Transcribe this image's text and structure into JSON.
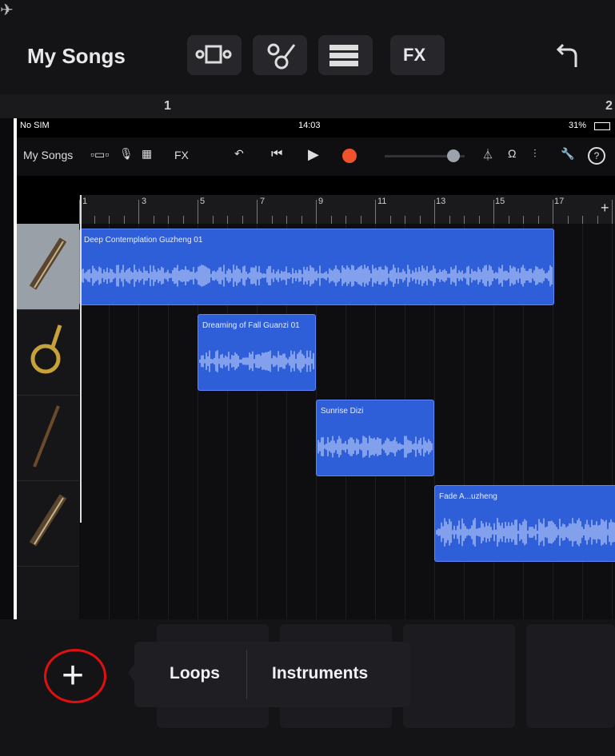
{
  "background_app": {
    "title": "My Songs",
    "fx_label": "FX",
    "ruler_numbers": [
      "1",
      "2"
    ],
    "toolbar_icons": [
      "track-view-icon",
      "smart-controls-icon",
      "mixer-icon",
      "undo-icon"
    ]
  },
  "embedded": {
    "status": {
      "carrier": "No SIM",
      "time": "14:03",
      "battery": "31%"
    },
    "toolbar": {
      "title": "My Songs",
      "fx_label": "FX",
      "icons": [
        "browser-icon",
        "mic-icon",
        "grid-icon",
        "undo-icon",
        "rewind-icon",
        "play-icon",
        "record-icon",
        "master-volume-slider",
        "metronome-icon",
        "count-in-icon",
        "mixer-icon",
        "settings-icon",
        "help-icon"
      ]
    },
    "ruler": {
      "numbers": [
        "1",
        "3",
        "5",
        "7",
        "9",
        "11",
        "13",
        "15",
        "17"
      ],
      "add_label": "+"
    },
    "tracks": [
      {
        "name": "guzheng-track",
        "region": "Deep Contemplation Guzheng 01"
      },
      {
        "name": "guanzi-track",
        "region": "Dreaming of Fall Guanzi 01"
      },
      {
        "name": "dizi-track",
        "region": "Sunrise Dizi"
      },
      {
        "name": "guzheng-track-2",
        "region": "Fade A...uzheng"
      }
    ]
  },
  "bottom": {
    "add_label": "+",
    "loops_label": "Loops",
    "instruments_label": "Instruments",
    "highlight_color": "#e01010"
  }
}
